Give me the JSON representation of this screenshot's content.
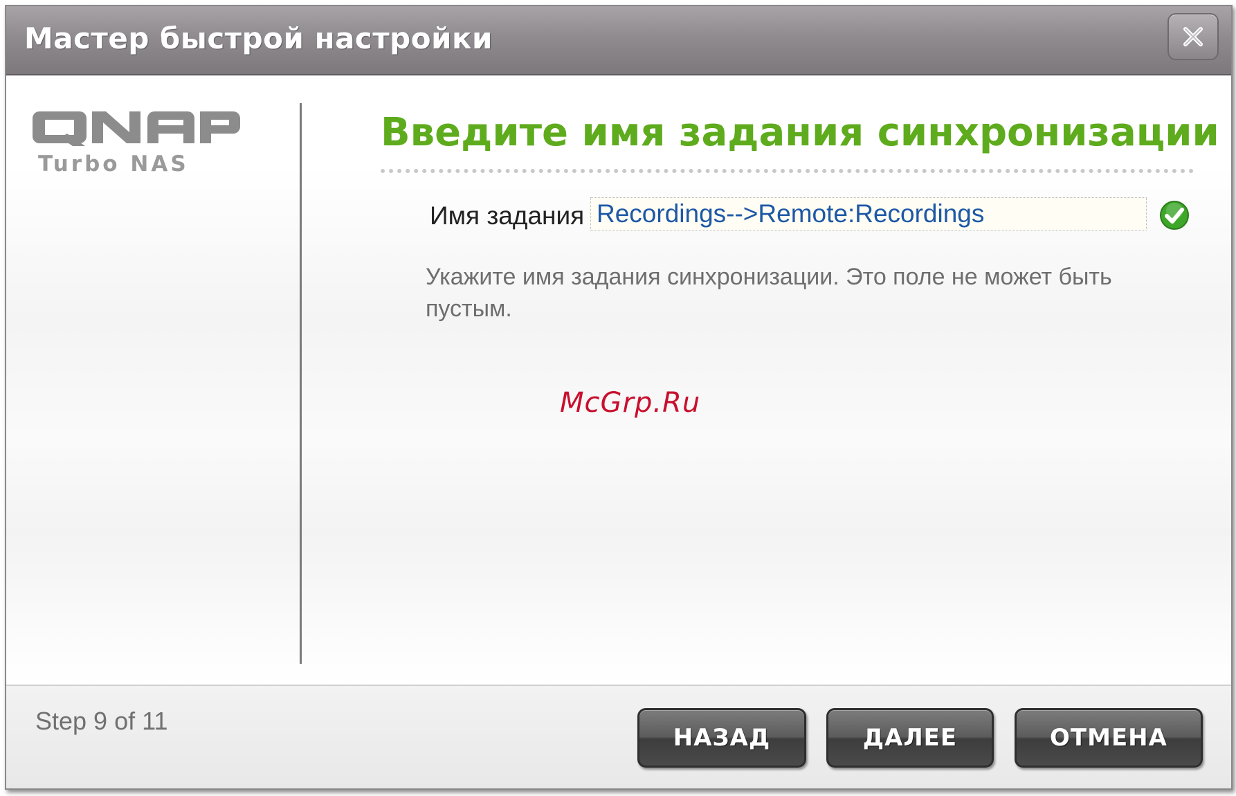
{
  "window": {
    "title": "Мастер быстрой настройки",
    "close_icon": "close-icon"
  },
  "logo": {
    "brand": "QNAP",
    "sub": "Turbo NAS"
  },
  "main": {
    "heading": "Введите имя задания синхронизации",
    "field_label": "Имя задания",
    "field_value": "Recordings-->Remote:Recordings",
    "status_icon": "check-circle-icon",
    "help": "Укажите имя задания синхронизации. Это поле не может быть пустым.",
    "watermark": "McGrp.Ru"
  },
  "footer": {
    "step": "Step 9 of 11",
    "back_label": "НАЗАД",
    "next_label": "ДАЛЕЕ",
    "cancel_label": "ОТМЕНА"
  },
  "colors": {
    "heading": "#5eab1d",
    "input_text": "#1d58a6",
    "titlebar": "#8f8b8f",
    "button": "#4a4a4a",
    "watermark": "#c8102e"
  }
}
